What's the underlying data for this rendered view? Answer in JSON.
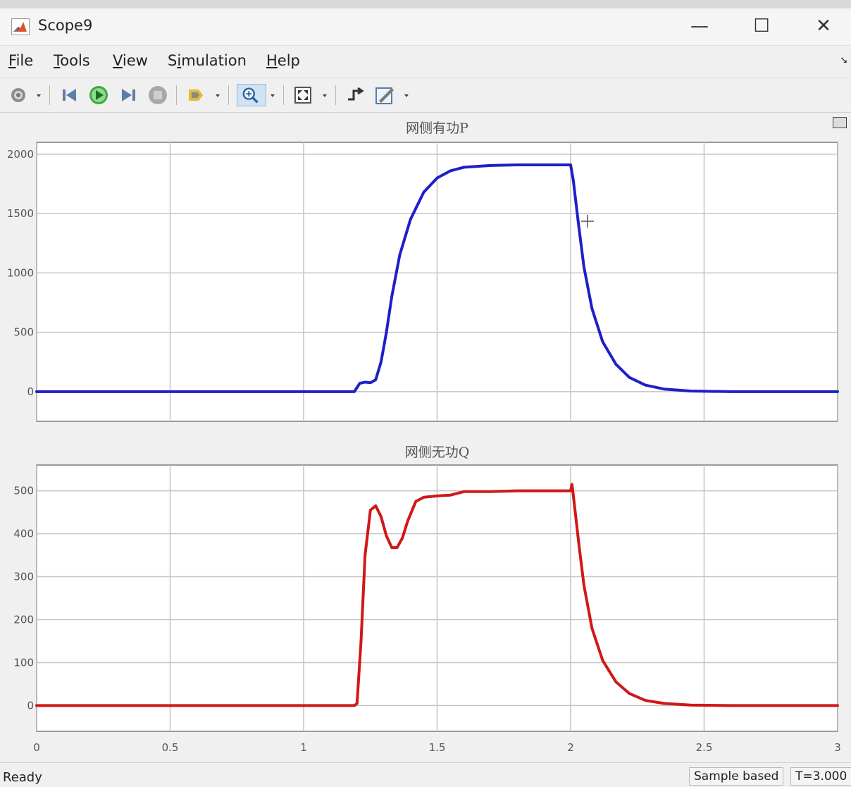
{
  "window": {
    "title": "Scope9",
    "controls": {
      "minimize": "—",
      "maximize": "☐",
      "close": "✕"
    }
  },
  "menu": [
    {
      "label": "File",
      "mnemonic": 0
    },
    {
      "label": "Tools",
      "mnemonic": 0
    },
    {
      "label": "View",
      "mnemonic": 0
    },
    {
      "label": "Simulation",
      "mnemonic": 1
    },
    {
      "label": "Help",
      "mnemonic": 0
    }
  ],
  "toolbar": {
    "icons": [
      "settings-icon",
      "step-back-icon",
      "run-icon",
      "step-forward-icon",
      "stop-icon",
      "highlight-icon",
      "zoom-icon",
      "fit-icon",
      "trigger-icon",
      "style-icon"
    ]
  },
  "status": {
    "ready": "Ready",
    "sample_mode": "Sample based",
    "time": "T=3.000"
  },
  "chart_data": [
    {
      "type": "line",
      "title": "网侧有功P",
      "xlim": [
        0,
        3
      ],
      "ylim": [
        -250,
        2100
      ],
      "xticks": [
        0,
        0.5,
        1,
        1.5,
        2,
        2.5,
        3
      ],
      "yticks": [
        0,
        500,
        1000,
        1500,
        2000
      ],
      "xtick_labels_shown": false,
      "grid": true,
      "series": [
        {
          "color": "#1f1fc8",
          "x": [
            0,
            1.19,
            1.21,
            1.23,
            1.25,
            1.27,
            1.29,
            1.31,
            1.33,
            1.36,
            1.4,
            1.45,
            1.5,
            1.55,
            1.6,
            1.7,
            1.8,
            1.9,
            2.0,
            2.01,
            2.03,
            2.05,
            2.08,
            2.12,
            2.17,
            2.22,
            2.28,
            2.35,
            2.45,
            2.6,
            3.0
          ],
          "y": [
            0,
            0,
            70,
            80,
            75,
            100,
            250,
            500,
            800,
            1150,
            1450,
            1680,
            1800,
            1860,
            1890,
            1905,
            1910,
            1910,
            1910,
            1780,
            1400,
            1050,
            700,
            420,
            230,
            120,
            55,
            22,
            5,
            0,
            0
          ]
        }
      ]
    },
    {
      "type": "line",
      "title": "网侧无功Q",
      "xlim": [
        0,
        3
      ],
      "ylim": [
        -60,
        560
      ],
      "xticks": [
        0,
        0.5,
        1,
        1.5,
        2,
        2.5,
        3
      ],
      "yticks": [
        0,
        100,
        200,
        300,
        400,
        500
      ],
      "xtick_labels": [
        "0",
        "0.5",
        "1",
        "1.5",
        "2",
        "2.5",
        "3"
      ],
      "grid": true,
      "series": [
        {
          "color": "#d01818",
          "x": [
            0,
            1.19,
            1.2,
            1.215,
            1.23,
            1.25,
            1.27,
            1.29,
            1.31,
            1.33,
            1.35,
            1.37,
            1.39,
            1.42,
            1.45,
            1.5,
            1.55,
            1.6,
            1.7,
            1.8,
            1.9,
            2.0,
            2.005,
            2.01,
            2.03,
            2.05,
            2.08,
            2.12,
            2.17,
            2.22,
            2.28,
            2.35,
            2.45,
            2.6,
            3.0
          ],
          "y": [
            0,
            0,
            5,
            150,
            350,
            455,
            465,
            440,
            395,
            368,
            368,
            390,
            430,
            475,
            485,
            488,
            490,
            498,
            498,
            500,
            500,
            500,
            515,
            490,
            380,
            280,
            180,
            105,
            55,
            28,
            12,
            5,
            1,
            0,
            0
          ]
        }
      ]
    }
  ]
}
